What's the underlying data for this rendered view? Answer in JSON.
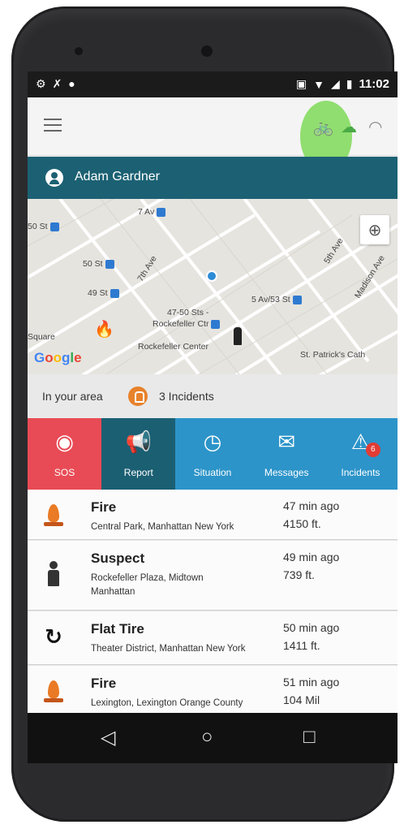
{
  "status_bar": {
    "left_icons": [
      "settings-icon",
      "no-signal-icon",
      "app-icon"
    ],
    "right_icons": [
      "vibrate-icon",
      "wifi-icon",
      "cell-signal-icon",
      "battery-icon"
    ],
    "time": "11:02"
  },
  "toolbar": {
    "icons": [
      "menu-icon",
      "bike-icon",
      "weather-icon",
      "wifi-status-icon"
    ]
  },
  "user": {
    "name": "Adam Gardner"
  },
  "map": {
    "labels": [
      {
        "text": "7 Av",
        "station": true
      },
      {
        "text": "50 St",
        "station": true
      },
      {
        "text": "50 St",
        "station": true
      },
      {
        "text": "49 St",
        "station": true
      },
      {
        "text": "7th Ave",
        "station": false
      },
      {
        "text": "5th Ave",
        "station": false
      },
      {
        "text": "Madison Ave",
        "station": false
      },
      {
        "text": "5 Av/53 St",
        "station": true
      },
      {
        "text": "47-50 Sts -",
        "station": false
      },
      {
        "text": "Rockefeller Ctr",
        "station": true
      },
      {
        "text": "Rockefeller Center",
        "station": false
      },
      {
        "text": "Square",
        "station": false
      },
      {
        "text": "St. Patrick's Cath",
        "station": false
      }
    ],
    "attribution": "Google"
  },
  "area": {
    "label": "In your area",
    "count_text": "3 Incidents"
  },
  "actions": [
    {
      "label": "SOS",
      "icon": "sos-icon",
      "glyph": "◉"
    },
    {
      "label": "Report",
      "icon": "megaphone-icon",
      "glyph": "📢"
    },
    {
      "label": "Situation",
      "icon": "clock-icon",
      "glyph": "◷"
    },
    {
      "label": "Messages",
      "icon": "mail-icon",
      "glyph": "✉"
    },
    {
      "label": "Incidents",
      "icon": "alarm-icon",
      "glyph": "⚠",
      "badge": "6"
    }
  ],
  "incidents": [
    {
      "title": "Fire",
      "address": "Central Park, Manhattan New York",
      "time": "47 min ago",
      "distance": "4150 ft.",
      "icon": "fire-icon"
    },
    {
      "title": "Suspect",
      "address": "Rockefeller Plaza, Midtown Manhattan",
      "time": "49 min ago",
      "distance": "739 ft.",
      "icon": "person-icon"
    },
    {
      "title": "Flat Tire",
      "address": "Theater District, Manhattan New York",
      "time": "50 min ago",
      "distance": "1411 ft.",
      "icon": "flat-tire-icon"
    },
    {
      "title": "Fire",
      "address": "Lexington, Lexington Orange County",
      "time": "51 min ago",
      "distance": "104 Mil",
      "icon": "fire-icon"
    }
  ],
  "navbar": {
    "back": "◁",
    "home": "○",
    "recents": "□"
  },
  "colors": {
    "sos": "#e84b55",
    "report": "#1b5f73",
    "action_blue": "#2c94c9",
    "userbar": "#1b6173",
    "accent_green": "#7ed957",
    "fire": "#ea7a25"
  }
}
